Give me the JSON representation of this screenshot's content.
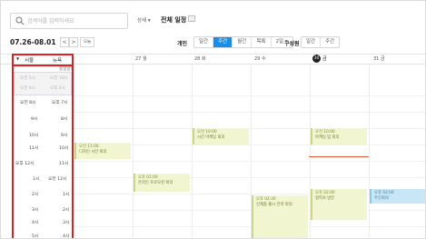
{
  "search": {
    "placeholder": "검색어를 입력하세요"
  },
  "detail_button": "상세",
  "calendar_title": "전체 일정",
  "date_range": "07.26-08.01",
  "nav": {
    "prev": "<",
    "next": ">",
    "today": "오늘"
  },
  "view_groups": [
    {
      "label": "개인",
      "options": [
        "일간",
        "주간",
        "월간",
        "목록",
        "2일"
      ],
      "active": "주간"
    },
    {
      "label": "구성원",
      "options": [
        "일간",
        "주간"
      ],
      "active": ""
    }
  ],
  "timezone_header": {
    "left": "서울",
    "right": "뉴욕"
  },
  "days": [
    {
      "label": "27 월",
      "today": false
    },
    {
      "label": "28 화",
      "today": false
    },
    {
      "label": "29 수",
      "today": false
    },
    {
      "label": "금",
      "date": "30",
      "today": true
    },
    {
      "label": "31 금",
      "today": false
    }
  ],
  "allday_label": "종일일정",
  "gray_cells": [
    {
      "seoul": "오전 5시",
      "ny": "오전 10시"
    },
    {
      "seoul": "오전 6시",
      "ny": "오후 4시"
    }
  ],
  "time_rows": [
    {
      "seoul": "오전 8시",
      "ny": "오후 7시"
    },
    {
      "seoul": "9시",
      "ny": "8시"
    },
    {
      "seoul": "10시",
      "ny": "9시"
    },
    {
      "seoul": "11시",
      "ny": "10시"
    },
    {
      "seoul": "오후 12시",
      "ny": "11시"
    },
    {
      "seoul": "1시",
      "ny": "오전 12시"
    },
    {
      "seoul": "2시",
      "ny": "1시"
    },
    {
      "seoul": "3시",
      "ny": "2시"
    },
    {
      "seoul": "4시",
      "ny": "3시"
    },
    {
      "seoul": "5시",
      "ny": "4시"
    }
  ],
  "events": [
    {
      "time": "오전 11:00",
      "name": "디자인 시안 회의"
    },
    {
      "time": "오전 10:00",
      "name": "시간 마케팅 회의"
    },
    {
      "time": "오전 10:00",
      "name": "마케팅 팀 회의"
    },
    {
      "time": "오후 01:00",
      "name": "온라인 프로모션 회의"
    },
    {
      "time": "오후 02:00",
      "name": "협력사 방문"
    },
    {
      "time": "오후 02:30",
      "name": "신제품 출시 전략 회의"
    },
    {
      "time": "오후 02:00",
      "name": "주간회의"
    }
  ]
}
